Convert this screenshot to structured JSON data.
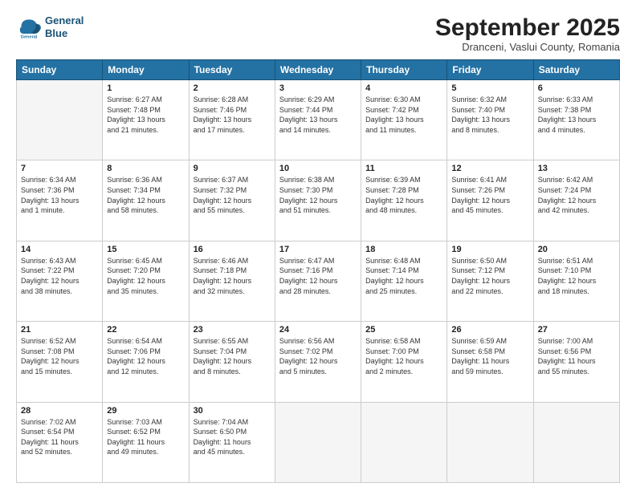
{
  "header": {
    "logo_line1": "General",
    "logo_line2": "Blue",
    "month": "September 2025",
    "location": "Dranceni, Vaslui County, Romania"
  },
  "weekdays": [
    "Sunday",
    "Monday",
    "Tuesday",
    "Wednesday",
    "Thursday",
    "Friday",
    "Saturday"
  ],
  "weeks": [
    [
      {
        "day": "",
        "info": ""
      },
      {
        "day": "1",
        "info": "Sunrise: 6:27 AM\nSunset: 7:48 PM\nDaylight: 13 hours\nand 21 minutes."
      },
      {
        "day": "2",
        "info": "Sunrise: 6:28 AM\nSunset: 7:46 PM\nDaylight: 13 hours\nand 17 minutes."
      },
      {
        "day": "3",
        "info": "Sunrise: 6:29 AM\nSunset: 7:44 PM\nDaylight: 13 hours\nand 14 minutes."
      },
      {
        "day": "4",
        "info": "Sunrise: 6:30 AM\nSunset: 7:42 PM\nDaylight: 13 hours\nand 11 minutes."
      },
      {
        "day": "5",
        "info": "Sunrise: 6:32 AM\nSunset: 7:40 PM\nDaylight: 13 hours\nand 8 minutes."
      },
      {
        "day": "6",
        "info": "Sunrise: 6:33 AM\nSunset: 7:38 PM\nDaylight: 13 hours\nand 4 minutes."
      }
    ],
    [
      {
        "day": "7",
        "info": "Sunrise: 6:34 AM\nSunset: 7:36 PM\nDaylight: 13 hours\nand 1 minute."
      },
      {
        "day": "8",
        "info": "Sunrise: 6:36 AM\nSunset: 7:34 PM\nDaylight: 12 hours\nand 58 minutes."
      },
      {
        "day": "9",
        "info": "Sunrise: 6:37 AM\nSunset: 7:32 PM\nDaylight: 12 hours\nand 55 minutes."
      },
      {
        "day": "10",
        "info": "Sunrise: 6:38 AM\nSunset: 7:30 PM\nDaylight: 12 hours\nand 51 minutes."
      },
      {
        "day": "11",
        "info": "Sunrise: 6:39 AM\nSunset: 7:28 PM\nDaylight: 12 hours\nand 48 minutes."
      },
      {
        "day": "12",
        "info": "Sunrise: 6:41 AM\nSunset: 7:26 PM\nDaylight: 12 hours\nand 45 minutes."
      },
      {
        "day": "13",
        "info": "Sunrise: 6:42 AM\nSunset: 7:24 PM\nDaylight: 12 hours\nand 42 minutes."
      }
    ],
    [
      {
        "day": "14",
        "info": "Sunrise: 6:43 AM\nSunset: 7:22 PM\nDaylight: 12 hours\nand 38 minutes."
      },
      {
        "day": "15",
        "info": "Sunrise: 6:45 AM\nSunset: 7:20 PM\nDaylight: 12 hours\nand 35 minutes."
      },
      {
        "day": "16",
        "info": "Sunrise: 6:46 AM\nSunset: 7:18 PM\nDaylight: 12 hours\nand 32 minutes."
      },
      {
        "day": "17",
        "info": "Sunrise: 6:47 AM\nSunset: 7:16 PM\nDaylight: 12 hours\nand 28 minutes."
      },
      {
        "day": "18",
        "info": "Sunrise: 6:48 AM\nSunset: 7:14 PM\nDaylight: 12 hours\nand 25 minutes."
      },
      {
        "day": "19",
        "info": "Sunrise: 6:50 AM\nSunset: 7:12 PM\nDaylight: 12 hours\nand 22 minutes."
      },
      {
        "day": "20",
        "info": "Sunrise: 6:51 AM\nSunset: 7:10 PM\nDaylight: 12 hours\nand 18 minutes."
      }
    ],
    [
      {
        "day": "21",
        "info": "Sunrise: 6:52 AM\nSunset: 7:08 PM\nDaylight: 12 hours\nand 15 minutes."
      },
      {
        "day": "22",
        "info": "Sunrise: 6:54 AM\nSunset: 7:06 PM\nDaylight: 12 hours\nand 12 minutes."
      },
      {
        "day": "23",
        "info": "Sunrise: 6:55 AM\nSunset: 7:04 PM\nDaylight: 12 hours\nand 8 minutes."
      },
      {
        "day": "24",
        "info": "Sunrise: 6:56 AM\nSunset: 7:02 PM\nDaylight: 12 hours\nand 5 minutes."
      },
      {
        "day": "25",
        "info": "Sunrise: 6:58 AM\nSunset: 7:00 PM\nDaylight: 12 hours\nand 2 minutes."
      },
      {
        "day": "26",
        "info": "Sunrise: 6:59 AM\nSunset: 6:58 PM\nDaylight: 11 hours\nand 59 minutes."
      },
      {
        "day": "27",
        "info": "Sunrise: 7:00 AM\nSunset: 6:56 PM\nDaylight: 11 hours\nand 55 minutes."
      }
    ],
    [
      {
        "day": "28",
        "info": "Sunrise: 7:02 AM\nSunset: 6:54 PM\nDaylight: 11 hours\nand 52 minutes."
      },
      {
        "day": "29",
        "info": "Sunrise: 7:03 AM\nSunset: 6:52 PM\nDaylight: 11 hours\nand 49 minutes."
      },
      {
        "day": "30",
        "info": "Sunrise: 7:04 AM\nSunset: 6:50 PM\nDaylight: 11 hours\nand 45 minutes."
      },
      {
        "day": "",
        "info": ""
      },
      {
        "day": "",
        "info": ""
      },
      {
        "day": "",
        "info": ""
      },
      {
        "day": "",
        "info": ""
      }
    ]
  ]
}
